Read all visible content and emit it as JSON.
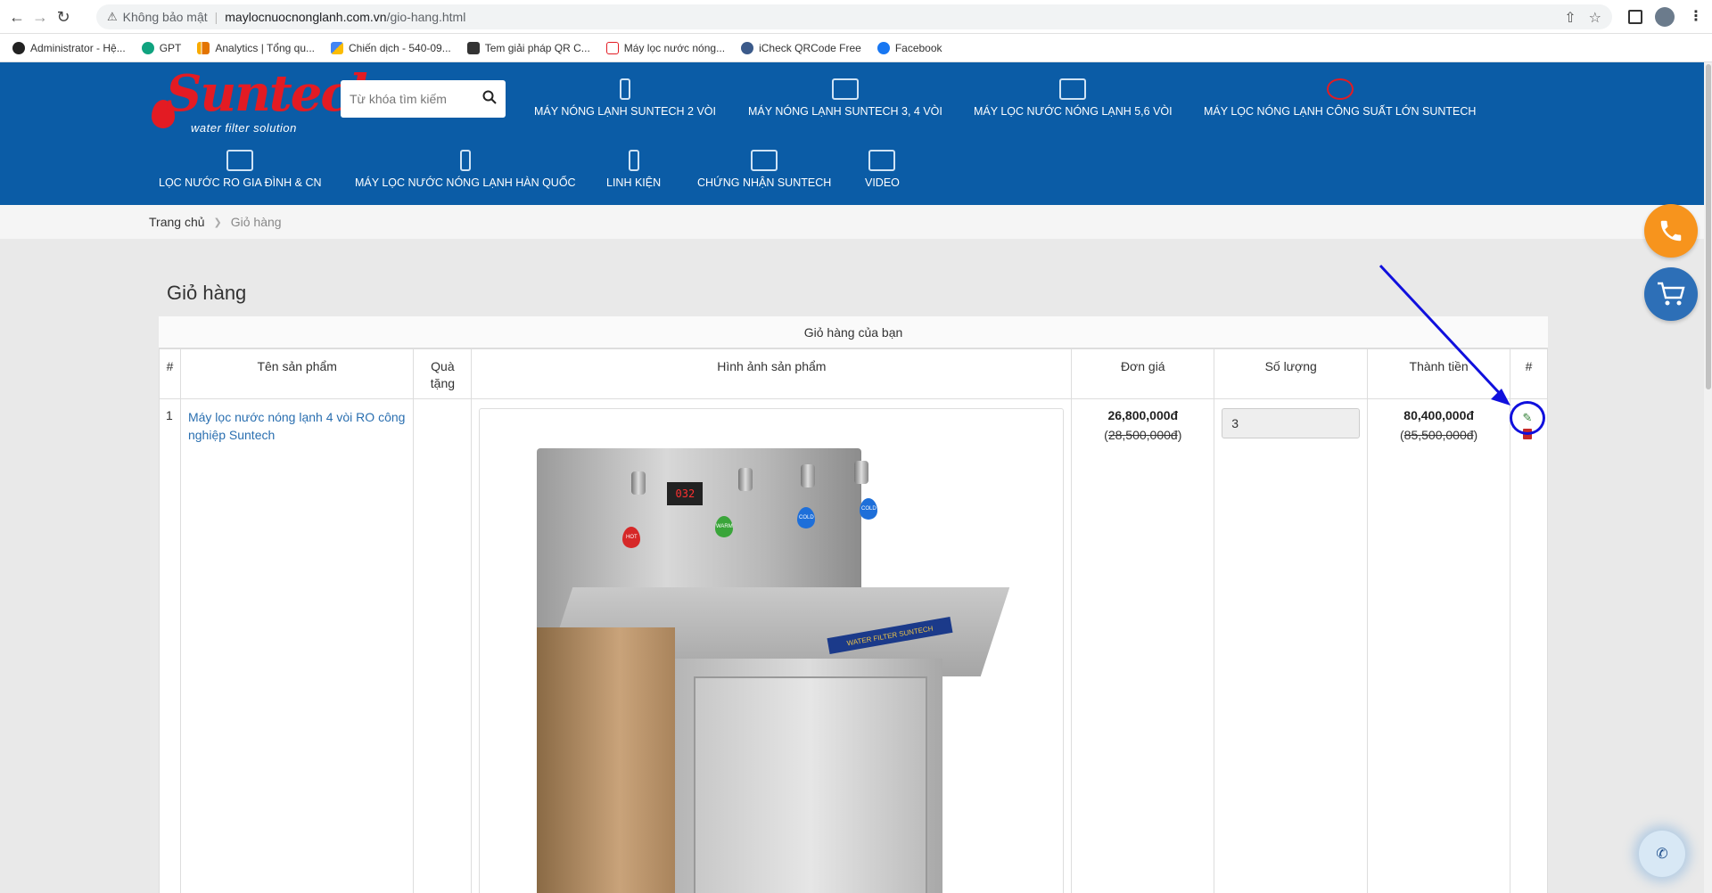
{
  "browser": {
    "security_label": "Không bảo mật",
    "url_host": "maylocnuocnonglanh.com.vn",
    "url_path": "/gio-hang.html"
  },
  "bookmarks": [
    {
      "label": "Administrator - Hệ...",
      "icon": "admin-icon"
    },
    {
      "label": "GPT",
      "icon": "gpt-icon"
    },
    {
      "label": "Analytics | Tổng qu...",
      "icon": "analytics-icon"
    },
    {
      "label": "Chiến dịch - 540-09...",
      "icon": "ads-icon"
    },
    {
      "label": "Tem giải pháp QR C...",
      "icon": "qr-icon"
    },
    {
      "label": "Máy lọc nước nóng...",
      "icon": "suntech-icon"
    },
    {
      "label": "iCheck QRCode Free",
      "icon": "icheck-icon"
    },
    {
      "label": "Facebook",
      "icon": "facebook-icon"
    }
  ],
  "site": {
    "logo_text": "Suntech",
    "logo_tagline": "water filter solution",
    "search_placeholder": "Từ khóa tìm kiếm",
    "menu_row1": [
      "MÁY NÓNG LẠNH SUNTECH 2 VÒI",
      "MÁY NÓNG LẠNH SUNTECH 3, 4 VÒI",
      "MÁY LỌC NƯỚC NÓNG LẠNH 5,6 VÒI",
      "MÁY LỌC NÓNG LẠNH CÔNG SUẤT LỚN SUNTECH"
    ],
    "menu_row2": [
      "LỌC NƯỚC RO GIA ĐÌNH & CN",
      "MÁY LỌC NƯỚC NÓNG LẠNH HÀN QUỐC",
      "LINH KIỆN",
      "CHỨNG NHẬN SUNTECH",
      "VIDEO"
    ]
  },
  "breadcrumb": {
    "home": "Trang chủ",
    "current": "Giỏ hàng"
  },
  "cart": {
    "title": "Giỏ hàng",
    "caption": "Giỏ hàng của bạn",
    "columns": [
      "#",
      "Tên sản phẩm",
      "Quà tặng",
      "Hình ảnh sản phẩm",
      "Đơn giá",
      "Số lượng",
      "Thành tiền",
      "#"
    ],
    "rows": [
      {
        "index": "1",
        "name": "Máy lọc nước nóng lạnh 4 vòi RO công nghiệp Suntech",
        "gift": "",
        "unit_price": "26,800,000đ",
        "unit_price_old": "28,500,000đ",
        "quantity": "3",
        "total": "80,400,000đ",
        "total_old": "85,500,000đ",
        "image_labels": {
          "display": "032",
          "hot": "HOT",
          "warm": "WARM",
          "cold1": "COLD",
          "cold2": "COLD",
          "brand": "WATER FILTER SUNTECH"
        }
      }
    ]
  },
  "colors": {
    "header_blue": "#0b5ca6",
    "logo_red": "#e31b23",
    "phone_orange": "#f7941d",
    "cart_blue": "#2d6fb7",
    "annotation_blue": "#1010dd"
  }
}
